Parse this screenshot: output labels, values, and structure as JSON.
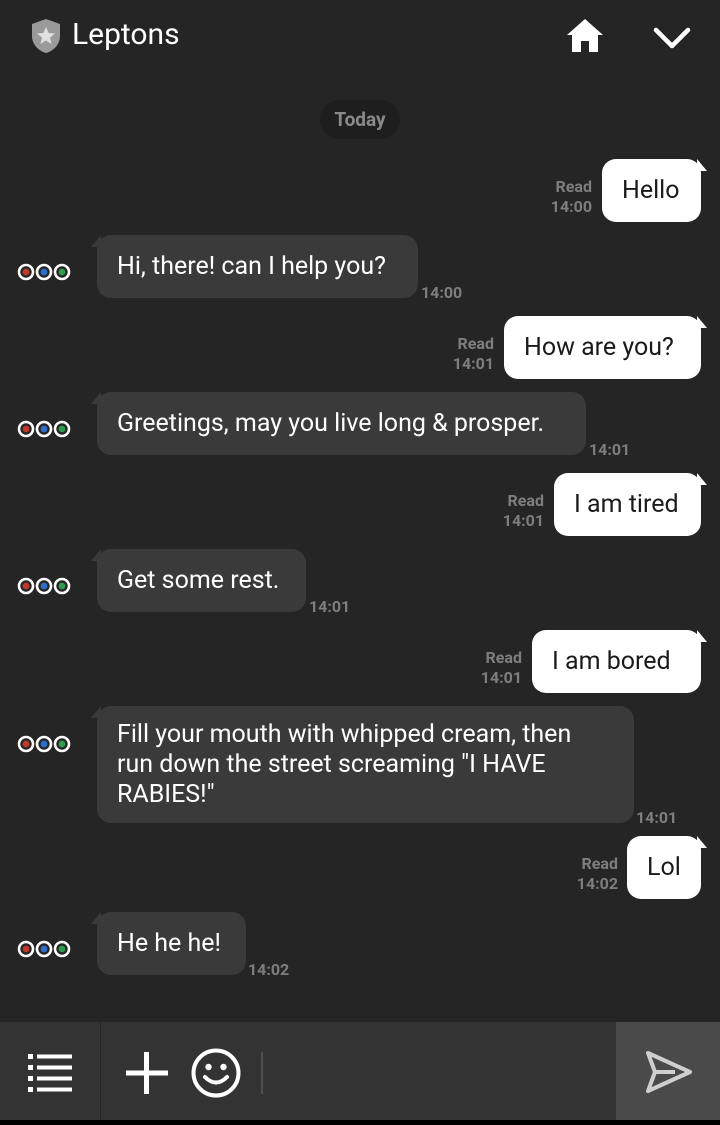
{
  "header": {
    "title": "Leptons",
    "icons": [
      "shield-star-icon",
      "home-icon",
      "chevron-down-icon"
    ]
  },
  "date_divider": "Today",
  "messages": [
    {
      "direction": "out",
      "text": "Hello",
      "status": "Read",
      "time": "14:00"
    },
    {
      "direction": "in",
      "text": "Hi, there! can I help you?",
      "time": "14:00"
    },
    {
      "direction": "out",
      "text": "How are you?",
      "status": "Read",
      "time": "14:01"
    },
    {
      "direction": "in",
      "text": "Greetings, may you live long & prosper.",
      "time": "14:01"
    },
    {
      "direction": "out",
      "text": "I am tired",
      "status": "Read",
      "time": "14:01"
    },
    {
      "direction": "in",
      "text": "Get some rest.",
      "time": "14:01"
    },
    {
      "direction": "out",
      "text": "I am bored",
      "status": "Read",
      "time": "14:01"
    },
    {
      "direction": "in",
      "text": "Fill your mouth with whipped cream, then run down the street screaming \"I HAVE RABIES!\"",
      "lines": [
        "Fill your mouth with whipped cream, then",
        "run down the street screaming \"I HAVE",
        "RABIES!\""
      ],
      "time": "14:01"
    },
    {
      "direction": "out",
      "text": "Lol",
      "status": "Read",
      "time": "14:02"
    },
    {
      "direction": "in",
      "text": "He he he!",
      "time": "14:02"
    }
  ],
  "composer": {
    "icons": [
      "menu-icon",
      "plus-icon",
      "emoji-icon",
      "send-icon"
    ],
    "input_value": ""
  },
  "colors": {
    "background": "#252525",
    "outgoing_bubble": "#ffffff",
    "incoming_bubble": "#3a3a3a",
    "meta_text": "#7e7e7e",
    "composer": "#333333",
    "send_button": "#4a4a4a"
  }
}
